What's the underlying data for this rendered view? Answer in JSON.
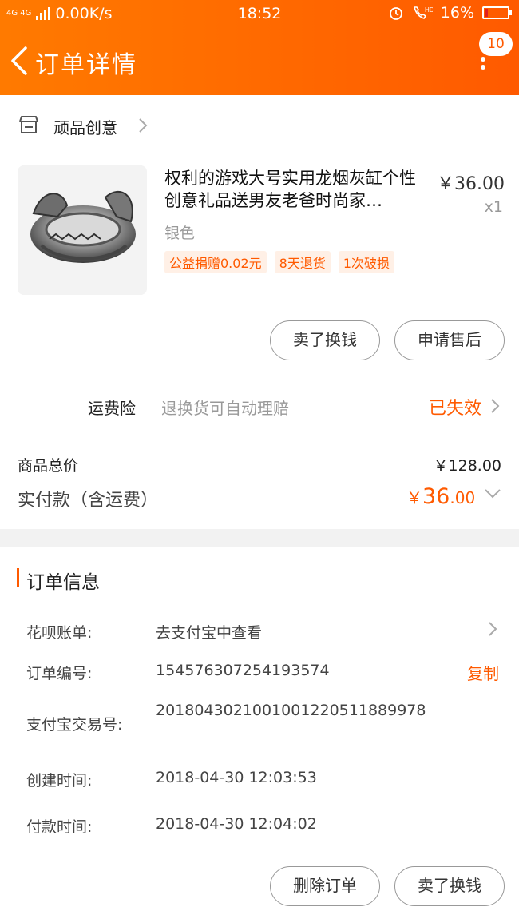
{
  "status_bar": {
    "network": "4G 4G",
    "speed": "0.00K/s",
    "time": "18:52",
    "battery": "16%",
    "battery_level": 0.16
  },
  "header": {
    "title": "订单详情",
    "badge_count": "10"
  },
  "shop": {
    "name": "顽品创意"
  },
  "product": {
    "title": "权利的游戏大号实用龙烟灰缸个性创意礼品送男友老爸时尚家…",
    "price": "￥36.00",
    "quantity": "x1",
    "spec": "银色",
    "tags": [
      "公益捐赠0.02元",
      "8天退货",
      "1次破损"
    ]
  },
  "item_actions": {
    "sell": "卖了换钱",
    "after_sale": "申请售后"
  },
  "insurance": {
    "label": "运费险",
    "description": "退换货可自动理赔",
    "status": "已失效"
  },
  "totals": {
    "goods_label": "商品总价",
    "goods_value": "￥128.00",
    "paid_label": "实付款（含运费）",
    "paid_currency": "￥",
    "paid_integer": "36",
    "paid_decimal": ".00"
  },
  "order_info": {
    "title": "订单信息",
    "rows": [
      {
        "label": "花呗账单:",
        "value": "去支付宝中查看"
      },
      {
        "label": "订单编号:",
        "value": "154576307254193574",
        "action": "复制"
      },
      {
        "label": "支付宝交易号:",
        "value": "2018043021001001220511889978"
      },
      {
        "label": "创建时间:",
        "value": "2018-04-30 12:03:53"
      },
      {
        "label": "付款时间:",
        "value": "2018-04-30 12:04:02"
      }
    ]
  },
  "bottom_actions": {
    "delete": "删除订单",
    "sell": "卖了换钱"
  },
  "colors": {
    "accent": "#ff5a00",
    "header_start": "#ff7a00"
  }
}
